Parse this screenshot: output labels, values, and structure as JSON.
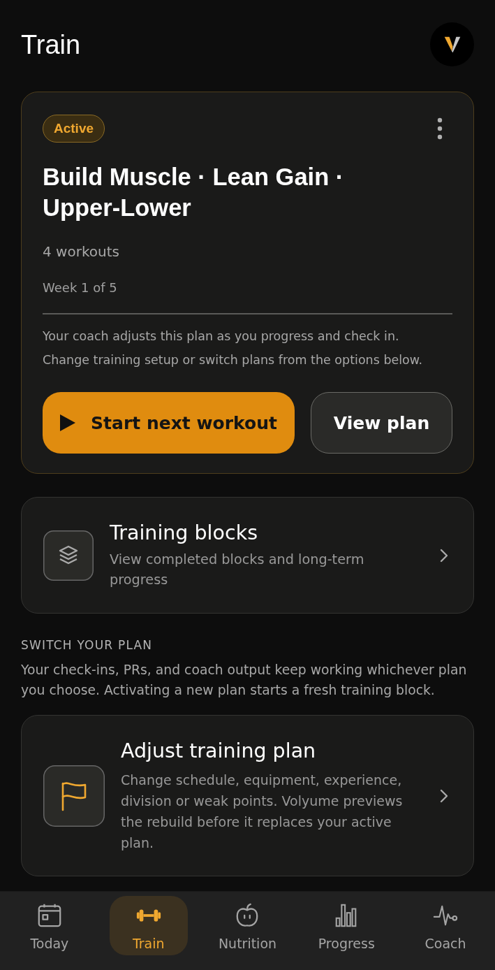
{
  "header": {
    "title": "Train"
  },
  "plan_card": {
    "badge": "Active",
    "title": "Build Muscle · Lean Gain · Upper-Lower",
    "workouts": "4 workouts",
    "week": "Week 1 of 5",
    "description": "Your coach adjusts this plan as you progress and check in. Change training setup or switch plans from the options below.",
    "buttons": [
      {
        "label": "Start next workout",
        "kind": "primary"
      },
      {
        "label": "View plan",
        "kind": "secondary"
      }
    ]
  },
  "training_blocks": {
    "title": "Training blocks",
    "subtitle": "View completed blocks and long-term progress"
  },
  "switch_section": {
    "heading": "SWITCH YOUR PLAN",
    "description": "Your check-ins, PRs, and coach output keep working whichever plan you choose. Activating a new plan starts a fresh training block."
  },
  "options": [
    {
      "title": "Adjust training plan",
      "description": "Change schedule, equipment, experience, division or weak points. Volyume previews the rebuild before it replaces your active plan."
    }
  ],
  "bottom_nav": [
    {
      "label": "Today",
      "selected": false
    },
    {
      "label": "Train",
      "selected": true
    },
    {
      "label": "Nutrition",
      "selected": false
    },
    {
      "label": "Progress",
      "selected": false
    },
    {
      "label": "Coach",
      "selected": false
    }
  ]
}
